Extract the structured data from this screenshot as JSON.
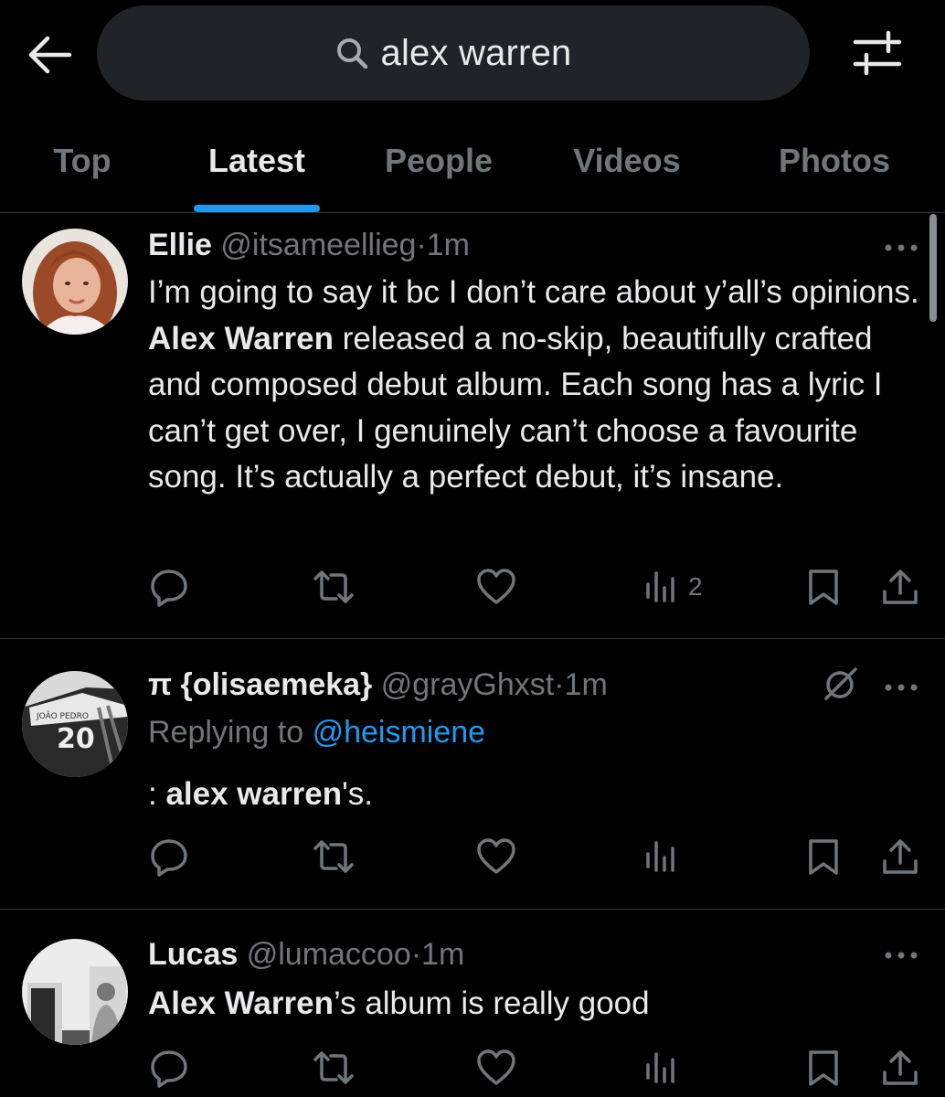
{
  "search": {
    "query": "alex warren"
  },
  "tabs": [
    {
      "label": "Top"
    },
    {
      "label": "Latest"
    },
    {
      "label": "People"
    },
    {
      "label": "Videos"
    },
    {
      "label": "Photos"
    }
  ],
  "active_tab": "Latest",
  "accent_color": "#1d9bf0",
  "posts": [
    {
      "name": "Ellie",
      "handle": "@itsameellieg",
      "dot": "·",
      "time": "1m",
      "body_before": "I’m going to say it bc I don’t care about y’all’s opinions. ",
      "body_bold": "Alex Warren",
      "body_after": " released a no-skip, beautifully crafted and composed debut album. Each song has a lyric I can’t get over, I genuinely can’t choose a favourite song. It’s actually a perfect debut, it’s insane.",
      "views": "2"
    },
    {
      "name": "π {olisaemeka}",
      "handle": "@grayGhxst",
      "dot": "·",
      "time": "1m",
      "replying_label": "Replying to",
      "replying_to": "@heismiene",
      "body_before": ": ",
      "body_bold": "alex warren",
      "body_after": "'s.",
      "views": ""
    },
    {
      "name": "Lucas",
      "handle": "@lumaccoo",
      "dot": "·",
      "time": "1m",
      "body_before": "",
      "body_bold": "Alex Warren",
      "body_after": "’s album is really good",
      "views": ""
    }
  ]
}
